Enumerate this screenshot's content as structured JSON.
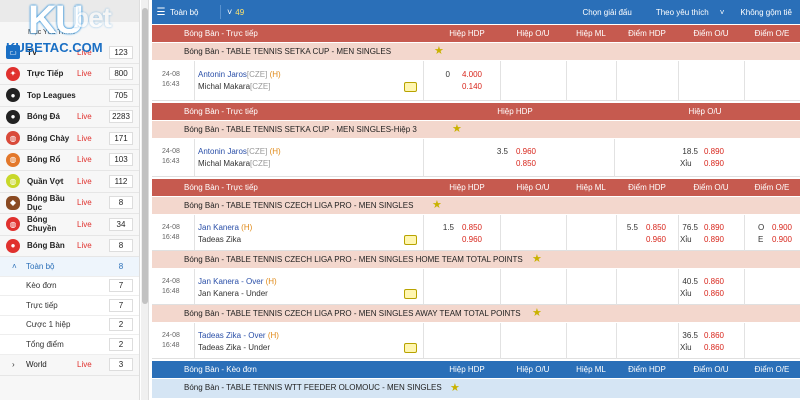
{
  "logo": {
    "mark": "KU",
    "mark2": "bet",
    "sub": "KUBETAC.COM"
  },
  "sidebar": {
    "top_label": "Mục Yêu Thích",
    "sports": [
      {
        "name": "TV",
        "live": "Live",
        "count": "123",
        "icon": "tv-icon",
        "color": "#1a6fc4"
      },
      {
        "name": "Trực Tiếp",
        "live": "Live",
        "count": "800",
        "icon": "running-icon",
        "color": "#e0312e"
      },
      {
        "name": "Top Leagues",
        "live": "",
        "count": "705",
        "icon": "soccer-ball-icon",
        "color": "#222222"
      },
      {
        "name": "Bóng Đá",
        "live": "Live",
        "count": "2283",
        "icon": "soccer-ball-icon",
        "color": "#222222"
      },
      {
        "name": "Bóng Chày",
        "live": "Live",
        "count": "171",
        "icon": "baseball-icon",
        "color": "#d94a3a"
      },
      {
        "name": "Bóng Rổ",
        "live": "Live",
        "count": "103",
        "icon": "basketball-icon",
        "color": "#e3782b"
      },
      {
        "name": "Quần Vợt",
        "live": "Live",
        "count": "112",
        "icon": "tennis-ball-icon",
        "color": "#c8d82a"
      },
      {
        "name": "Bóng Bầu Dục",
        "live": "Live",
        "count": "8",
        "icon": "rugby-ball-icon",
        "color": "#8a4a22"
      },
      {
        "name": "Bóng Chuyền",
        "live": "Live",
        "count": "34",
        "icon": "volleyball-icon",
        "color": "#e0312e"
      },
      {
        "name": "Bóng Bàn",
        "live": "Live",
        "count": "8",
        "icon": "table-tennis-icon",
        "color": "#e0312e"
      }
    ],
    "subs": [
      {
        "name": "Toàn bộ",
        "count": "8"
      },
      {
        "name": "Kèo đơn",
        "count": "7"
      },
      {
        "name": "Trực tiếp",
        "count": "7"
      },
      {
        "name": "Cược 1 hiệp",
        "count": "2"
      },
      {
        "name": "Tổng điểm",
        "count": "2"
      }
    ],
    "world": {
      "name": "World",
      "live": "Live",
      "count": "3"
    }
  },
  "topbar": {
    "all": "Toàn bộ",
    "count": "49",
    "select_league": "Chọn giải đấu",
    "sort": "Theo yêu thích",
    "no_merge": "Không gộm tiê"
  },
  "columns": {
    "hdp1": "Hiệp HDP",
    "ou1": "Hiệp O/U",
    "ml1": "Hiệp ML",
    "hdp": "Điểm HDP",
    "ou": "Điểm O/U",
    "oe": "Điểm O/E"
  },
  "sections": [
    {
      "header": "Bóng Bàn - Trực tiếp",
      "league": "Bóng Bàn - TABLE TENNIS SETKA CUP - MEN SINGLES",
      "match": {
        "date": "24-08",
        "time": "16:43",
        "home": "Antonin Jaros",
        "home_cc": "[CZE]",
        "home_h": "(H)",
        "away": "Michal Makara",
        "away_cc": "[CZE]",
        "hdp1": "0",
        "hdp1_home": "4.000",
        "hdp1_away": "0.140"
      }
    },
    {
      "header": "Bóng Bàn - Trực tiếp",
      "col_hdp": "Hiệp HDP",
      "col_ou": "Hiệp O/U",
      "league": "Bóng Bàn - TABLE TENNIS SETKA CUP - MEN SINGLES-Hiệp 3",
      "match": {
        "date": "24-08",
        "time": "16:43",
        "home": "Antonin Jaros",
        "home_cc": "[CZE]",
        "home_h": "(H)",
        "away": "Michal Makara",
        "away_cc": "[CZE]",
        "hdp": "3.5",
        "hdp_home": "0.960",
        "hdp_away": "0.850",
        "ou": "18.5",
        "ou_over": "0.890",
        "ou_under_lbl": "Xỉu",
        "ou_under": "0.890"
      }
    },
    {
      "header": "Bóng Bàn - Trực tiếp",
      "league": "Bóng Bàn - TABLE TENNIS CZECH LIGA PRO - MEN SINGLES",
      "match": {
        "date": "24-08",
        "time": "16:48",
        "home": "Jan Kanera",
        "home_h": "(H)",
        "away": "Tadeas Zika",
        "hdp1": "1.5",
        "hdp1_home": "0.850",
        "hdp1_away": "0.960",
        "hdp": "5.5",
        "hdp_home": "0.850",
        "hdp_away": "0.960",
        "ou": "76.5",
        "ou_over": "0.890",
        "ou_under_lbl": "Xỉu",
        "ou_under": "0.890",
        "oe_o_lbl": "O",
        "oe_o": "0.900",
        "oe_e_lbl": "E",
        "oe_e": "0.900"
      }
    },
    {
      "league": "Bóng Bàn - TABLE TENNIS CZECH LIGA PRO - MEN SINGLES HOME TEAM TOTAL POINTS",
      "match": {
        "date": "24-08",
        "time": "16:48",
        "home": "Jan Kanera - Over",
        "home_h": "(H)",
        "away": "Jan Kanera - Under",
        "ou": "40.5",
        "ou_over": "0.860",
        "ou_under_lbl": "Xỉu",
        "ou_under": "0.860"
      }
    },
    {
      "league": "Bóng Bàn - TABLE TENNIS CZECH LIGA PRO - MEN SINGLES AWAY TEAM TOTAL POINTS",
      "match": {
        "date": "24-08",
        "time": "16:48",
        "home": "Tadeas Zika - Over",
        "home_h": "(H)",
        "away": "Tadeas Zika - Under",
        "ou": "36.5",
        "ou_over": "0.860",
        "ou_under_lbl": "Xỉu",
        "ou_under": "0.860"
      }
    },
    {
      "header": "Bóng Bàn - Kèo đơn",
      "league": "Bóng Bàn - TABLE TENNIS WTT FEEDER OLOMOUC - MEN SINGLES"
    }
  ],
  "colors": {
    "blue": "#2a6fb8",
    "red_header": "#c65a4f",
    "league_bg": "#f3d7cd",
    "odds_red": "#d8261c"
  }
}
